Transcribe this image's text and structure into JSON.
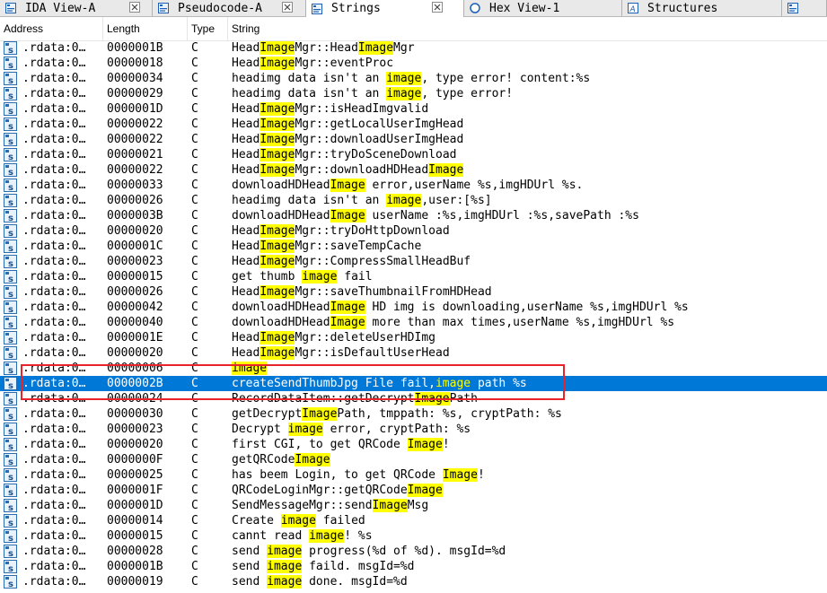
{
  "tabs": [
    {
      "label": "IDA View-A",
      "icon": "ida-view-icon",
      "closable": true,
      "active": false
    },
    {
      "label": "Pseudocode-A",
      "icon": "pseudocode-icon",
      "closable": true,
      "active": false
    },
    {
      "label": "Strings",
      "icon": "strings-icon",
      "closable": true,
      "active": true
    },
    {
      "label": "Hex View-1",
      "icon": "hex-view-icon",
      "closable": false,
      "active": false
    },
    {
      "label": "Structures",
      "icon": "structures-icon",
      "closable": false,
      "active": false
    }
  ],
  "columns": {
    "address": "Address",
    "length": "Length",
    "type": "Type",
    "string": "String"
  },
  "colors": {
    "selection": "#0078d7",
    "highlight": "#ffff00",
    "annotation": "#e8232c"
  },
  "search_term": "image",
  "selected_row": 22,
  "annotation_rows": [
    21,
    23
  ],
  "rows": [
    {
      "address": ".rdata:0…",
      "length": "0000001B",
      "type": "C",
      "string": "HeadImageMgr::HeadImageMgr"
    },
    {
      "address": ".rdata:0…",
      "length": "00000018",
      "type": "C",
      "string": "HeadImageMgr::eventProc"
    },
    {
      "address": ".rdata:0…",
      "length": "00000034",
      "type": "C",
      "string": "headimg data isn't an image, type error! content:%s"
    },
    {
      "address": ".rdata:0…",
      "length": "00000029",
      "type": "C",
      "string": "headimg data isn't an image, type error!"
    },
    {
      "address": ".rdata:0…",
      "length": "0000001D",
      "type": "C",
      "string": "HeadImageMgr::isHeadImgvalid"
    },
    {
      "address": ".rdata:0…",
      "length": "00000022",
      "type": "C",
      "string": "HeadImageMgr::getLocalUserImgHead"
    },
    {
      "address": ".rdata:0…",
      "length": "00000022",
      "type": "C",
      "string": "HeadImageMgr::downloadUserImgHead"
    },
    {
      "address": ".rdata:0…",
      "length": "00000021",
      "type": "C",
      "string": "HeadImageMgr::tryDoSceneDownload"
    },
    {
      "address": ".rdata:0…",
      "length": "00000022",
      "type": "C",
      "string": "HeadImageMgr::downloadHDHeadImage"
    },
    {
      "address": ".rdata:0…",
      "length": "00000033",
      "type": "C",
      "string": "downloadHDHeadImage error,userName %s,imgHDUrl %s."
    },
    {
      "address": ".rdata:0…",
      "length": "00000026",
      "type": "C",
      "string": "headimg data isn't an image,user:[%s]"
    },
    {
      "address": ".rdata:0…",
      "length": "0000003B",
      "type": "C",
      "string": "downloadHDHeadImage userName :%s,imgHDUrl :%s,savePath :%s"
    },
    {
      "address": ".rdata:0…",
      "length": "00000020",
      "type": "C",
      "string": "HeadImageMgr::tryDoHttpDownload"
    },
    {
      "address": ".rdata:0…",
      "length": "0000001C",
      "type": "C",
      "string": "HeadImageMgr::saveTempCache"
    },
    {
      "address": ".rdata:0…",
      "length": "00000023",
      "type": "C",
      "string": "HeadImageMgr::CompressSmallHeadBuf"
    },
    {
      "address": ".rdata:0…",
      "length": "00000015",
      "type": "C",
      "string": "get thumb image fail"
    },
    {
      "address": ".rdata:0…",
      "length": "00000026",
      "type": "C",
      "string": "HeadImageMgr::saveThumbnailFromHDHead"
    },
    {
      "address": ".rdata:0…",
      "length": "00000042",
      "type": "C",
      "string": "downloadHDHeadImage HD img is downloading,userName %s,imgHDUrl %s"
    },
    {
      "address": ".rdata:0…",
      "length": "00000040",
      "type": "C",
      "string": "downloadHDHeadImage more than max times,userName %s,imgHDUrl %s"
    },
    {
      "address": ".rdata:0…",
      "length": "0000001E",
      "type": "C",
      "string": "HeadImageMgr::deleteUserHDImg"
    },
    {
      "address": ".rdata:0…",
      "length": "00000020",
      "type": "C",
      "string": "HeadImageMgr::isDefaultUserHead"
    },
    {
      "address": ".rdata:0…",
      "length": "00000006",
      "type": "C",
      "string": "image"
    },
    {
      "address": ".rdata:0…",
      "length": "0000002B",
      "type": "C",
      "string": "createSendThumbJpg File fail,image path %s"
    },
    {
      "address": ".rdata:0…",
      "length": "00000024",
      "type": "C",
      "string": "RecordDataItem::getDecryptImagePath"
    },
    {
      "address": ".rdata:0…",
      "length": "00000030",
      "type": "C",
      "string": "getDecryptImagePath, tmppath: %s, cryptPath: %s"
    },
    {
      "address": ".rdata:0…",
      "length": "00000023",
      "type": "C",
      "string": "Decrypt image error, cryptPath: %s"
    },
    {
      "address": ".rdata:0…",
      "length": "00000020",
      "type": "C",
      "string": "first CGI, to get QRCode Image!"
    },
    {
      "address": ".rdata:0…",
      "length": "0000000F",
      "type": "C",
      "string": "getQRCodeImage"
    },
    {
      "address": ".rdata:0…",
      "length": "00000025",
      "type": "C",
      "string": "has beem Login, to get QRCode Image!"
    },
    {
      "address": ".rdata:0…",
      "length": "0000001F",
      "type": "C",
      "string": "QRCodeLoginMgr::getQRCodeImage"
    },
    {
      "address": ".rdata:0…",
      "length": "0000001D",
      "type": "C",
      "string": "SendMessageMgr::sendImageMsg"
    },
    {
      "address": ".rdata:0…",
      "length": "00000014",
      "type": "C",
      "string": "Create image failed"
    },
    {
      "address": ".rdata:0…",
      "length": "00000015",
      "type": "C",
      "string": "cannt read image! %s"
    },
    {
      "address": ".rdata:0…",
      "length": "00000028",
      "type": "C",
      "string": "send image progress(%d of %d). msgId=%d"
    },
    {
      "address": ".rdata:0…",
      "length": "0000001B",
      "type": "C",
      "string": "send image faild. msgId=%d"
    },
    {
      "address": ".rdata:0…",
      "length": "00000019",
      "type": "C",
      "string": "send image done. msgId=%d"
    }
  ]
}
